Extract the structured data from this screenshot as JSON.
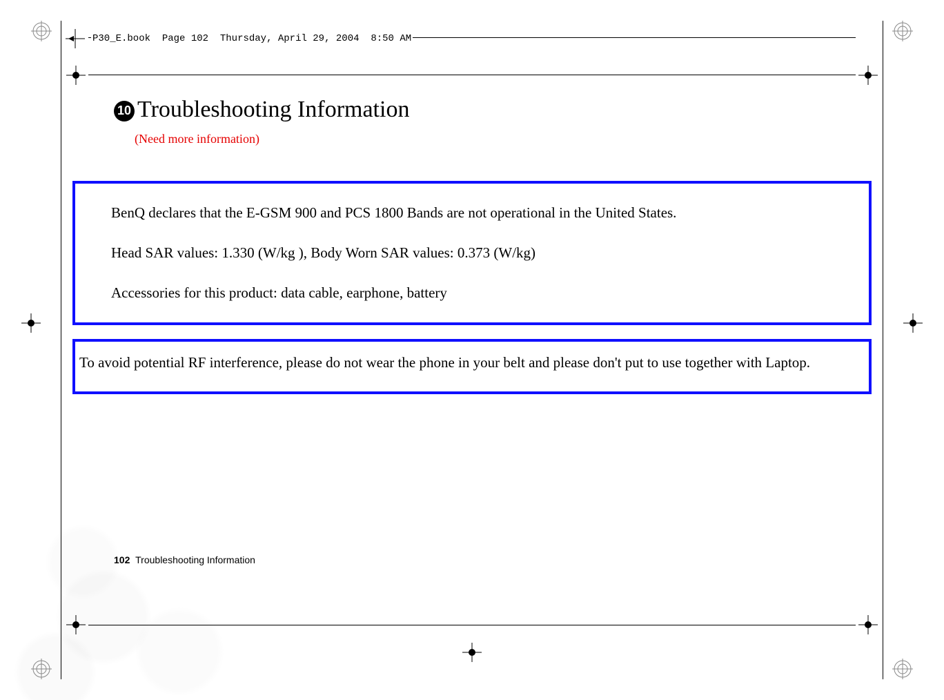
{
  "header": {
    "file": "P30_E.book",
    "page_label": "Page 102",
    "date": "Thursday, April 29, 2004",
    "time": "8:50 AM"
  },
  "chapter": {
    "number": "10",
    "title": "Troubleshooting Information",
    "note": "(Need more information)"
  },
  "box1": {
    "p1": "BenQ declares that the E-GSM 900 and PCS 1800 Bands are not operational in the United States.",
    "p2": "Head SAR values: 1.330 (W/kg ), Body Worn SAR values: 0.373 (W/kg)",
    "p3": "Accessories for this product: data cable, earphone, battery"
  },
  "box2": {
    "p1": "To avoid potential RF interference, please do not wear the phone in your belt and please don't put to use together with Laptop."
  },
  "footer": {
    "page_number": "102",
    "section": "Troubleshooting Information"
  }
}
